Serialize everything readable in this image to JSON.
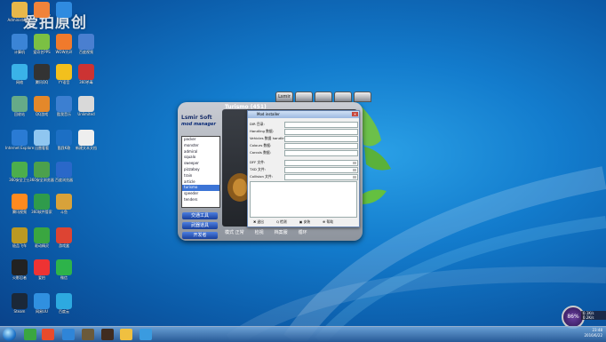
{
  "watermark": "爱拍原创",
  "desktop_icons": [
    {
      "label": "Administrat..."
    },
    {
      "label": ""
    },
    {
      "label": ""
    },
    {
      "label": "计算机"
    },
    {
      "label": "爱奇艺PPS"
    },
    {
      "label": "WOW光环"
    },
    {
      "label": "百度视频"
    },
    {
      "label": "网络"
    },
    {
      "label": "腾讯QQ"
    },
    {
      "label": "YY语音"
    },
    {
      "label": "360杀毒"
    },
    {
      "label": "回收站"
    },
    {
      "label": "QQ游戏"
    },
    {
      "label": "酷我音乐"
    },
    {
      "label": "Unlimited"
    },
    {
      "label": "Internet Explorer"
    },
    {
      "label": "迅雷看看"
    },
    {
      "label": "酷我K歌"
    },
    {
      "label": "新建文本文档"
    },
    {
      "label": "360安全卫士"
    },
    {
      "label": "360安全浏览器"
    },
    {
      "label": "百度浏览器"
    },
    {
      "label": "腾讯视频"
    },
    {
      "label": "360软件管家"
    },
    {
      "label": "斗鱼"
    },
    {
      "label": "极品飞车"
    },
    {
      "label": "驱动精灵"
    },
    {
      "label": "游戏盒"
    },
    {
      "label": "火影忍者"
    },
    {
      "label": "爱拍"
    },
    {
      "label": "微信"
    },
    {
      "label": "Steam"
    },
    {
      "label": "网易UU"
    },
    {
      "label": "百度云"
    }
  ],
  "app": {
    "car_title": "Turismo (451)",
    "brand_name": "Lsmir Soft",
    "brand_subtitle": "mod manager",
    "tabs": [
      "Lsmir",
      "",
      "",
      "",
      ""
    ],
    "mods": [
      "packer",
      "monster",
      "admiral",
      "squalo",
      "sweeper",
      "pizzaboy",
      "train",
      "article",
      "turismo",
      "speeder",
      "tenders"
    ],
    "selected_mod_index": 8,
    "side_buttons": [
      "交通工具",
      "武器道具",
      "开发者"
    ],
    "bottom_tabs": [
      "模式 正常",
      "检视",
      "档案服",
      "循环"
    ]
  },
  "dialog": {
    "title": "Mod installer",
    "fields": [
      {
        "label": "DIR 目录:"
      },
      {
        "label": "Handling 数据:"
      },
      {
        "label": "Vehicles 数据 handling:"
      },
      {
        "label": "Colours 数据:"
      },
      {
        "label": "Carcols 数据:"
      },
      {
        "label": "DFF 文件:"
      },
      {
        "label": "TXD 文件:"
      },
      {
        "label": "Collision 文件:"
      }
    ],
    "buttons": [
      "✖ 退出",
      "Q 检测",
      "▣ 安装",
      "⊕ 帮助"
    ]
  },
  "taskbar": {
    "clock_time": "23:48",
    "clock_date": "2016/6/22"
  },
  "gadget": {
    "value": "86",
    "unit": "%",
    "line1": "0.1K/s",
    "line2": "0.2K/s"
  },
  "colors": {
    "desktop": "#137ccd",
    "selection": "#3c74d6",
    "button_blue": "#1f56c4"
  }
}
